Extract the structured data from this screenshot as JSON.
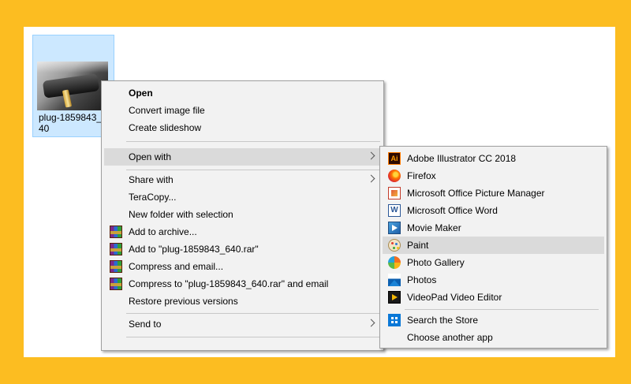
{
  "file": {
    "name": "plug-1859843_640"
  },
  "context_menu": {
    "items": [
      {
        "label": "Open"
      },
      {
        "label": "Convert image file"
      },
      {
        "label": "Create slideshow"
      },
      {
        "label": "Open with"
      },
      {
        "label": "Share with"
      },
      {
        "label": "TeraCopy..."
      },
      {
        "label": "New folder with selection"
      },
      {
        "label": "Add to archive..."
      },
      {
        "label": "Add to \"plug-1859843_640.rar\""
      },
      {
        "label": "Compress and email..."
      },
      {
        "label": "Compress to \"plug-1859843_640.rar\" and email"
      },
      {
        "label": "Restore previous versions"
      },
      {
        "label": "Send to"
      }
    ]
  },
  "open_with_menu": {
    "items": [
      {
        "label": "Adobe Illustrator CC 2018",
        "icon": "adobe-illustrator-icon"
      },
      {
        "label": "Firefox",
        "icon": "firefox-icon"
      },
      {
        "label": "Microsoft Office Picture Manager",
        "icon": "picture-manager-icon"
      },
      {
        "label": "Microsoft Office Word",
        "icon": "word-icon"
      },
      {
        "label": "Movie Maker",
        "icon": "movie-maker-icon"
      },
      {
        "label": "Paint",
        "icon": "paint-icon"
      },
      {
        "label": "Photo Gallery",
        "icon": "photo-gallery-icon"
      },
      {
        "label": "Photos",
        "icon": "photos-icon"
      },
      {
        "label": "VideoPad Video Editor",
        "icon": "videopad-icon"
      },
      {
        "label": "Search the Store",
        "icon": "store-icon"
      },
      {
        "label": "Choose another app"
      }
    ]
  },
  "colors": {
    "frame": "#FCBD21",
    "selection": "#cce8ff",
    "menu_bg": "#f2f2f2",
    "highlight": "#dadada"
  }
}
